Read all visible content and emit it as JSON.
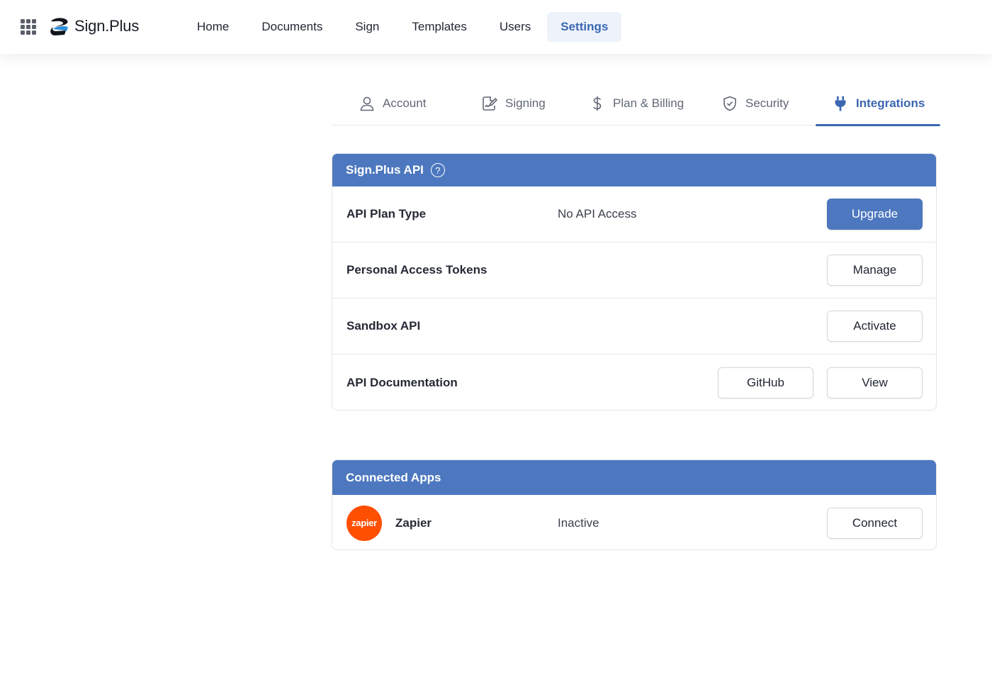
{
  "brand": {
    "name": "Sign.Plus",
    "accent_color": "#4d78bf",
    "active_color": "#3b67b1"
  },
  "topnav": {
    "items": [
      {
        "label": "Home"
      },
      {
        "label": "Documents"
      },
      {
        "label": "Sign"
      },
      {
        "label": "Templates"
      },
      {
        "label": "Users"
      },
      {
        "label": "Settings",
        "active": true
      }
    ]
  },
  "settings_tabs": [
    {
      "label": "Account",
      "icon": "user-icon"
    },
    {
      "label": "Signing",
      "icon": "signature-icon"
    },
    {
      "label": "Plan & Billing",
      "icon": "dollar-icon"
    },
    {
      "label": "Security",
      "icon": "shield-check-icon"
    },
    {
      "label": "Integrations",
      "icon": "plug-icon",
      "active": true
    }
  ],
  "api_section": {
    "title": "Sign.Plus API",
    "help_glyph": "?",
    "rows": [
      {
        "label": "API Plan Type",
        "value": "No API Access",
        "button": "Upgrade"
      },
      {
        "label": "Personal Access Tokens",
        "button": "Manage"
      },
      {
        "label": "Sandbox API",
        "button": "Activate"
      },
      {
        "label": "API Documentation",
        "buttons": [
          "GitHub",
          "View"
        ]
      }
    ]
  },
  "connected_apps": {
    "title": "Connected Apps",
    "apps": [
      {
        "logo_text": "zapier",
        "name": "Zapier",
        "status": "Inactive",
        "button": "Connect",
        "logo_color": "#ff4f00"
      }
    ]
  }
}
